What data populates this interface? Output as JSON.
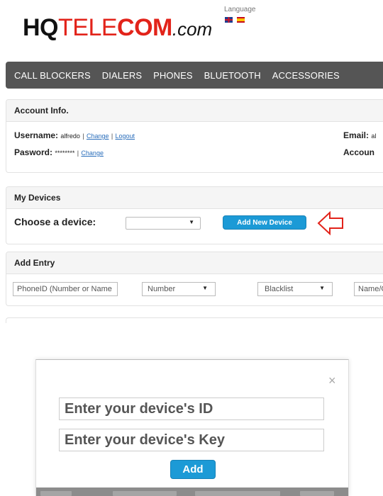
{
  "header": {
    "logo": {
      "hq": "HQ",
      "tele": "TELE",
      "com": "COM",
      "dotcom": ".com"
    },
    "language_label": "Language",
    "flags": [
      "uk-flag-icon",
      "spain-flag-icon"
    ]
  },
  "nav": {
    "items": [
      "CALL BLOCKERS",
      "DIALERS",
      "PHONES",
      "BLUETOOTH",
      "ACCESSORIES"
    ]
  },
  "account": {
    "title": "Account Info.",
    "username_label": "Username:",
    "username_value": "alfredo",
    "change_link": "Change",
    "logout_link": "Logout",
    "password_label": "Pasword:",
    "password_value": "********",
    "password_change_link": "Change",
    "email_label": "Email:",
    "email_value": "al",
    "account_label": "Accoun",
    "separator": "|"
  },
  "devices": {
    "title": "My Devices",
    "choose_label": "Choose a device:",
    "select_value": "",
    "add_button": "Add New Device"
  },
  "entry": {
    "title": "Add Entry",
    "phone_placeholder": "PhoneID (Number or Name",
    "type_value": "Number",
    "list_value": "Blacklist",
    "name_placeholder": "Name/C"
  },
  "modal": {
    "close": "×",
    "id_placeholder": "Enter your device's ID",
    "key_placeholder": "Enter your device's Key",
    "add_button": "Add"
  },
  "colors": {
    "brand_red": "#e2231a",
    "nav_bg": "#555555",
    "button_blue": "#1c9ad6",
    "link_blue": "#2a6ebb"
  }
}
